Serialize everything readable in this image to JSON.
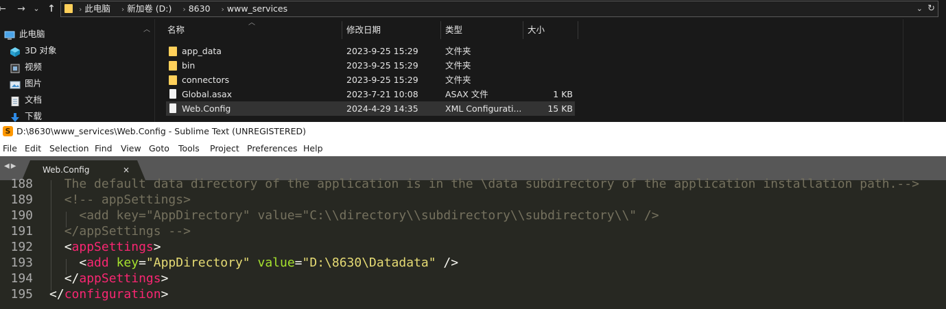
{
  "explorer": {
    "nav_back": "←",
    "nav_forward": "→",
    "nav_recent": "⌄",
    "nav_up": "↑",
    "breadcrumbs": [
      "此电脑",
      "新加卷 (D:)",
      "8630",
      "www_services"
    ],
    "crumb_sep": "›",
    "address_dropdown": "⌄",
    "refresh": "↻",
    "nav_items": [
      {
        "label": "此电脑",
        "icon": "computer-icon"
      },
      {
        "label": "3D 对象",
        "icon": "3d-objects-icon"
      },
      {
        "label": "视频",
        "icon": "video-icon"
      },
      {
        "label": "图片",
        "icon": "pictures-icon"
      },
      {
        "label": "文档",
        "icon": "documents-icon"
      },
      {
        "label": "下载",
        "icon": "download-icon"
      }
    ],
    "columns": {
      "name": "名称",
      "modified": "修改日期",
      "type": "类型",
      "size": "大小"
    },
    "files": [
      {
        "name": "app_data",
        "modified": "2023-9-25 15:29",
        "type": "文件夹",
        "size": "",
        "kind": "folder"
      },
      {
        "name": "bin",
        "modified": "2023-9-25 15:29",
        "type": "文件夹",
        "size": "",
        "kind": "folder"
      },
      {
        "name": "connectors",
        "modified": "2023-9-25 15:29",
        "type": "文件夹",
        "size": "",
        "kind": "folder"
      },
      {
        "name": "Global.asax",
        "modified": "2023-7-21 10:08",
        "type": "ASAX 文件",
        "size": "1 KB",
        "kind": "file"
      },
      {
        "name": "Web.Config",
        "modified": "2024-4-29 14:35",
        "type": "XML Configurati...",
        "size": "15 KB",
        "kind": "file",
        "selected": true
      }
    ]
  },
  "sublime": {
    "title": "D:\\8630\\www_services\\Web.Config - Sublime Text (UNREGISTERED)",
    "logo_glyph": "S",
    "menu": [
      "File",
      "Edit",
      "Selection",
      "Find",
      "View",
      "Goto",
      "Tools",
      "Project",
      "Preferences",
      "Help"
    ],
    "tab_nav": "◀▶",
    "tab": {
      "label": "Web.Config",
      "close": "×"
    },
    "lines": [
      {
        "num": "188",
        "indent": "  ",
        "tokens": [
          {
            "c": "cm",
            "t": "The default data directory of the application is in the \\data subdirectory of the application installation path.-->"
          }
        ]
      },
      {
        "num": "189",
        "indent": "  ",
        "tokens": [
          {
            "c": "cm",
            "t": "<!-- appSettings>"
          }
        ]
      },
      {
        "num": "190",
        "indent": "    ",
        "tokens": [
          {
            "c": "cm",
            "t": "<add key=\"AppDirectory\" value=\"C:\\\\directory\\\\subdirectory\\\\subdirectory\\\\\" />"
          }
        ]
      },
      {
        "num": "191",
        "indent": "  ",
        "tokens": [
          {
            "c": "cm",
            "t": "</appSettings -->"
          }
        ]
      },
      {
        "num": "192",
        "indent": "  ",
        "tokens": [
          {
            "c": "pu",
            "t": "<"
          },
          {
            "c": "tg",
            "t": "appSettings"
          },
          {
            "c": "pu",
            "t": ">"
          }
        ]
      },
      {
        "num": "193",
        "indent": "    ",
        "tokens": [
          {
            "c": "pu",
            "t": "<"
          },
          {
            "c": "tg",
            "t": "add"
          },
          {
            "c": "pu",
            "t": " "
          },
          {
            "c": "at",
            "t": "key"
          },
          {
            "c": "pu",
            "t": "="
          },
          {
            "c": "sv",
            "t": "\"AppDirectory\""
          },
          {
            "c": "pu",
            "t": " "
          },
          {
            "c": "at",
            "t": "value"
          },
          {
            "c": "pu",
            "t": "="
          },
          {
            "c": "sv",
            "t": "\"D:\\8630\\Datadata\""
          },
          {
            "c": "pu",
            "t": " />"
          }
        ]
      },
      {
        "num": "194",
        "indent": "  ",
        "tokens": [
          {
            "c": "pu",
            "t": "</"
          },
          {
            "c": "tg",
            "t": "appSettings"
          },
          {
            "c": "pu",
            "t": ">"
          }
        ]
      },
      {
        "num": "195",
        "indent": "",
        "tokens": [
          {
            "c": "pu",
            "t": "</"
          },
          {
            "c": "tg",
            "t": "configuration"
          },
          {
            "c": "pu",
            "t": ">"
          }
        ]
      }
    ]
  }
}
